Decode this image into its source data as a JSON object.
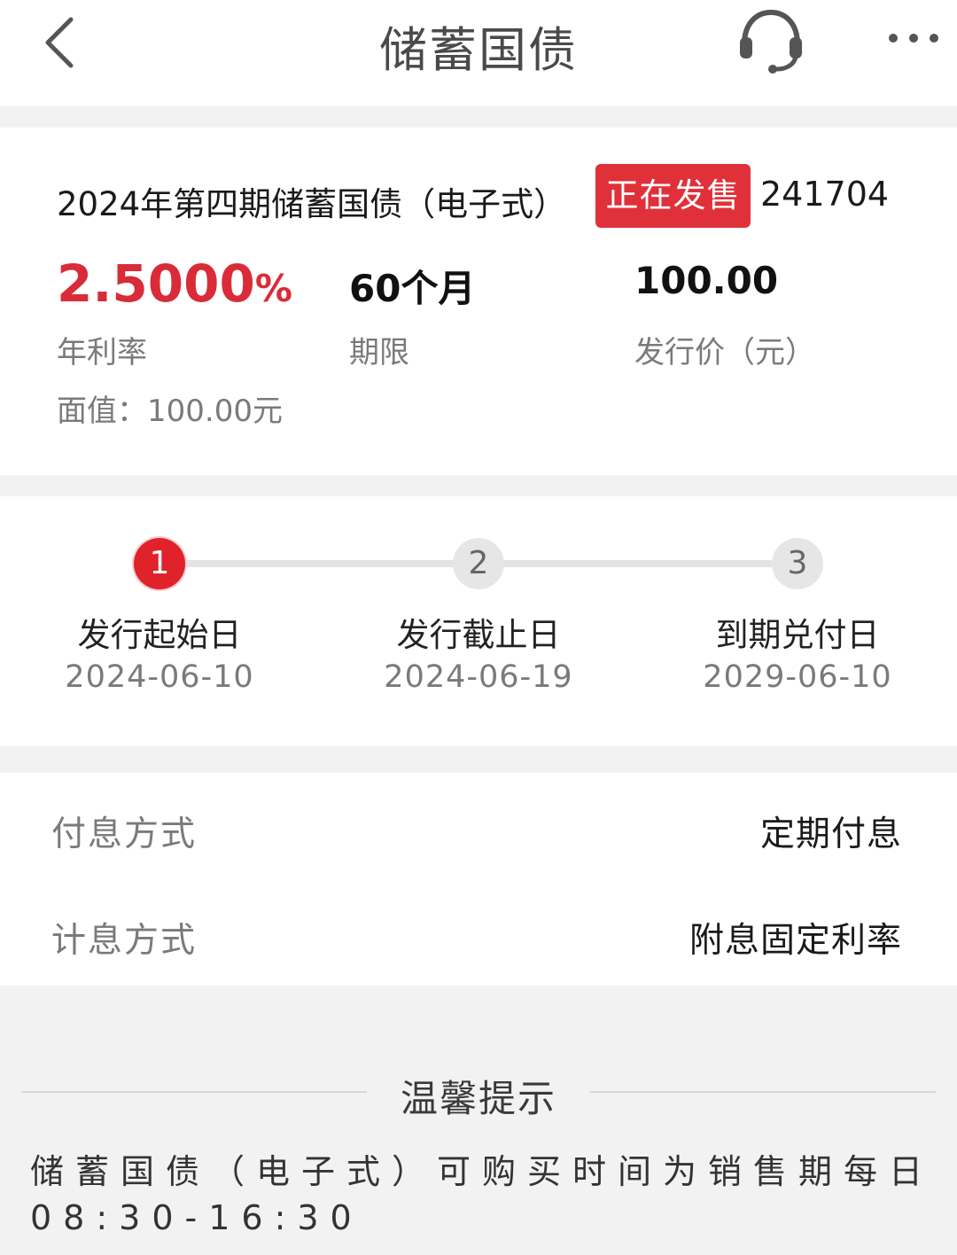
{
  "header": {
    "title": "储蓄国债",
    "back_icon": "chevron-left-icon",
    "service_icon": "headset-icon",
    "more_icon": "ellipsis-icon"
  },
  "product": {
    "title": "2024年第四期储蓄国债（电子式）",
    "status": "正在发售",
    "code": "241704",
    "rate_number": "2.5000",
    "rate_unit": "%",
    "rate_label": "年利率",
    "term_value": "60个月",
    "term_label": "期限",
    "price_value": "100.00",
    "price_label": "发行价（元）",
    "face_value": "面值：100.00元"
  },
  "steps": [
    {
      "number": "1",
      "name": "发行起始日",
      "date": "2024-06-10",
      "active": true
    },
    {
      "number": "2",
      "name": "发行截止日",
      "date": "2024-06-19",
      "active": false
    },
    {
      "number": "3",
      "name": "到期兑付日",
      "date": "2029-06-10",
      "active": false
    }
  ],
  "info": [
    {
      "label": "付息方式",
      "value": "定期付息"
    },
    {
      "label": "计息方式",
      "value": "附息固定利率"
    }
  ],
  "tips": {
    "title": "温馨提示",
    "text": "储蓄国债（电子式）可购买时间为销售期每日08:30-16:30"
  },
  "colors": {
    "accent_red": "#e0313b",
    "rate_red": "#d92c38",
    "page_bg": "#f2f2f2",
    "muted_text": "#7a7a7a"
  }
}
